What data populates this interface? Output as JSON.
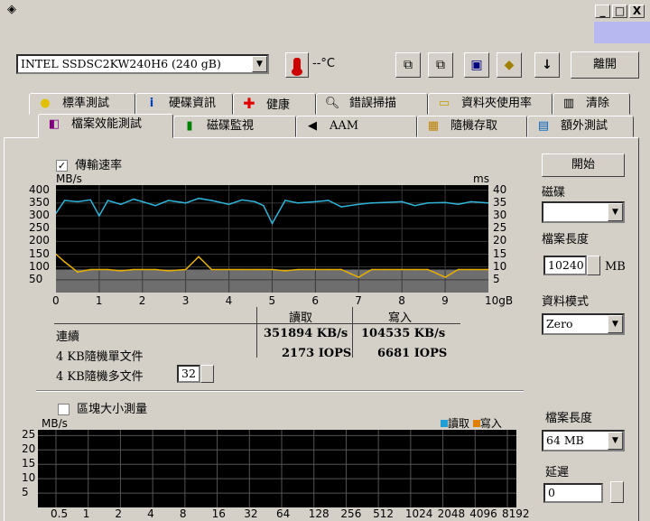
{
  "window": {
    "minimize": "_",
    "maximize": "□",
    "close": "X"
  },
  "toolbar": {
    "drive": "INTEL SSDSC2KW240H6 (240 gB)",
    "temperature": "--°C",
    "exit_label": "離開"
  },
  "tabs_top": [
    {
      "label": "標準測試",
      "icon": "bulb-icon"
    },
    {
      "label": "硬碟資訊",
      "icon": "info-icon"
    },
    {
      "label": "健康",
      "icon": "cross-icon"
    },
    {
      "label": "錯誤掃描",
      "icon": "magnifier-icon"
    },
    {
      "label": "資料夾使用率",
      "icon": "folder-icon"
    },
    {
      "label": "清除",
      "icon": "trash-icon"
    }
  ],
  "tabs_bottom": [
    {
      "label": "檔案效能測試",
      "icon": "file-bench-icon"
    },
    {
      "label": "磁碟監視",
      "icon": "monitor-icon"
    },
    {
      "label": "AAM",
      "icon": "speaker-icon"
    },
    {
      "label": "隨機存取",
      "icon": "random-icon"
    },
    {
      "label": "額外測試",
      "icon": "extra-icon"
    }
  ],
  "transfer": {
    "checkbox_label": "傳輸速率",
    "unit_left": "MB/s",
    "unit_right": "ms",
    "y_left": [
      "400",
      "350",
      "300",
      "250",
      "200",
      "150",
      "100",
      "50"
    ],
    "y_right": [
      "40",
      "35",
      "30",
      "25",
      "20",
      "15",
      "10",
      "5"
    ],
    "x_ticks": [
      "0",
      "1",
      "2",
      "3",
      "4",
      "5",
      "6",
      "7",
      "8",
      "9",
      "10gB"
    ]
  },
  "chart_data": {
    "type": "line",
    "xlabel": "",
    "ylabel": "MB/s",
    "ylim": [
      0,
      420
    ],
    "y2lim": [
      0,
      42
    ],
    "x": [
      0,
      0.2,
      0.5,
      0.8,
      1,
      1.2,
      1.5,
      1.8,
      2,
      2.3,
      2.6,
      3,
      3.3,
      3.6,
      4,
      4.3,
      4.6,
      4.8,
      5,
      5.3,
      5.6,
      6,
      6.3,
      6.6,
      7,
      7.3,
      7.6,
      8,
      8.3,
      8.6,
      9,
      9.3,
      9.6,
      10
    ],
    "series": [
      {
        "values": [
          310,
          360,
          355,
          362,
          300,
          360,
          345,
          365,
          355,
          340,
          360,
          350,
          368,
          360,
          345,
          362,
          355,
          340,
          270,
          360,
          350,
          355,
          360,
          335,
          345,
          350,
          352,
          355,
          340,
          350,
          352,
          345,
          355,
          350
        ]
      },
      {
        "values": [
          15,
          12,
          8,
          9,
          9,
          9,
          8.5,
          9,
          9,
          9,
          8.5,
          9,
          14,
          9,
          9,
          9,
          9,
          9,
          9,
          8.5,
          9,
          9,
          9,
          9,
          6,
          9,
          9,
          9,
          9,
          9,
          6,
          9,
          9,
          9
        ]
      }
    ]
  },
  "results": {
    "col_read": "讀取",
    "col_write": "寫入",
    "rows": [
      {
        "label": "連續",
        "read": "351894 KB/s",
        "write": "104535 KB/s"
      },
      {
        "label": "4 KB隨機單文件",
        "read": "2173 IOPS",
        "write": "6681 IOPS"
      },
      {
        "label": "4 KB隨機多文件",
        "read": "",
        "write": ""
      }
    ],
    "queue_depth": "32"
  },
  "side": {
    "start_label": "開始",
    "disk_label": "磁碟",
    "disk_value": "",
    "file_length_label": "檔案長度",
    "file_length_value": "10240",
    "file_length_unit": "MB",
    "data_mode_label": "資料模式",
    "data_mode_value": "Zero"
  },
  "block": {
    "checkbox_label": "區塊大小測量",
    "unit": "MB/s",
    "legend_read": "讀取",
    "legend_write": "寫入",
    "y_ticks": [
      "25",
      "20",
      "15",
      "10",
      "5"
    ],
    "x_ticks": [
      "0.5",
      "1",
      "2",
      "4",
      "8",
      "16",
      "32",
      "64",
      "128",
      "256",
      "512",
      "1024",
      "2048",
      "4096",
      "8192"
    ],
    "file_length_label": "檔案長度",
    "file_length_value": "64 MB",
    "delay_label": "延遲",
    "delay_value": "0",
    "read_color": "#1f9fd6",
    "write_color": "#e08000"
  }
}
